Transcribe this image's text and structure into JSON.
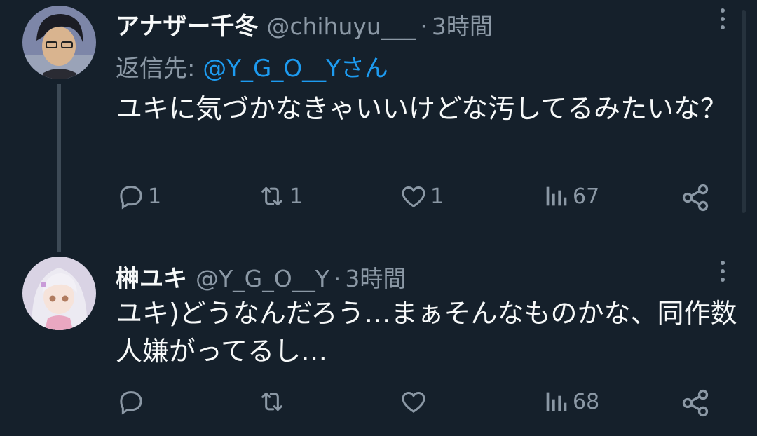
{
  "tweets": [
    {
      "display_name": "アナザー千冬",
      "handle": "@chihuyu___",
      "separator": "·",
      "time": "3時間",
      "reply_prefix": "返信先:",
      "reply_mention": "@Y_G_O__Yさん",
      "text": "ユキに気づかなきゃいいけどな汚してるみたいな？",
      "replies": "1",
      "retweets": "1",
      "likes": "1",
      "views": "67"
    },
    {
      "display_name": "榊ユキ",
      "handle": "@Y_G_O__Y",
      "separator": "·",
      "time": "3時間",
      "text": "ユキ)どうなんだろう…まぁそんなものかな、同作数人嫌がってるし…",
      "replies": "",
      "retweets": "",
      "likes": "",
      "views": "68"
    }
  ],
  "colors": {
    "background": "#15202b",
    "text": "#f7f9f9",
    "muted": "#8b98a5",
    "link": "#1d9bf0"
  },
  "icons": [
    "more-icon",
    "reply-icon",
    "retweet-icon",
    "like-icon",
    "views-icon",
    "share-icon"
  ]
}
